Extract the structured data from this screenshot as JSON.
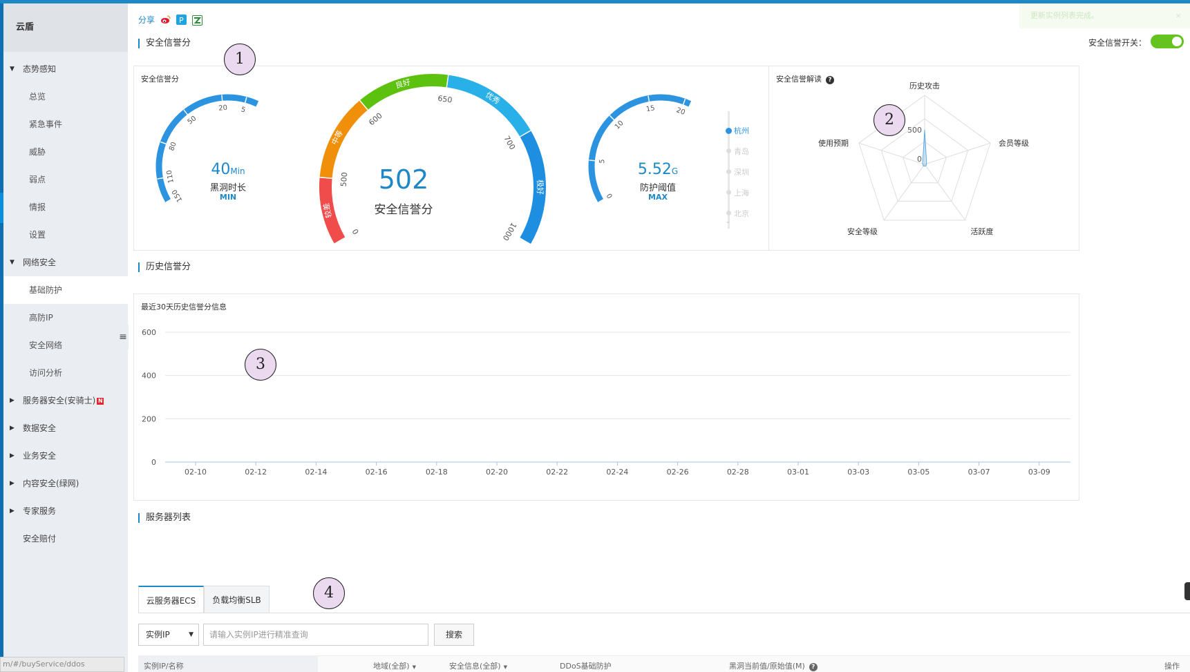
{
  "sidebar": {
    "title": "云盾",
    "items": [
      {
        "label": "态势感知",
        "type": "group",
        "expanded": true
      },
      {
        "label": "总览",
        "type": "child"
      },
      {
        "label": "紧急事件",
        "type": "child"
      },
      {
        "label": "威胁",
        "type": "child"
      },
      {
        "label": "弱点",
        "type": "child"
      },
      {
        "label": "情报",
        "type": "child"
      },
      {
        "label": "设置",
        "type": "child"
      },
      {
        "label": "网络安全",
        "type": "group",
        "expanded": true
      },
      {
        "label": "基础防护",
        "type": "child",
        "active": true
      },
      {
        "label": "高防IP",
        "type": "child"
      },
      {
        "label": "安全网络",
        "type": "child"
      },
      {
        "label": "访问分析",
        "type": "child"
      },
      {
        "label": "服务器安全(安骑士)",
        "type": "group",
        "expanded": false,
        "badge": "N"
      },
      {
        "label": "数据安全",
        "type": "group",
        "expanded": false
      },
      {
        "label": "业务安全",
        "type": "group",
        "expanded": false
      },
      {
        "label": "内容安全(绿网)",
        "type": "group",
        "expanded": false
      },
      {
        "label": "专家服务",
        "type": "group",
        "expanded": false
      },
      {
        "label": "安全赔付",
        "type": "plain"
      }
    ],
    "collapse_icon": "list-icon"
  },
  "header": {
    "share_label": "分享",
    "share_icons": [
      "weibo-icon",
      "qzone-icon",
      "wechat-icon"
    ],
    "toast": "更新实例列表完成。",
    "toast_close": "×"
  },
  "credit_section": {
    "title": "安全信誉分",
    "switch_label": "安全信誉开关：",
    "switch_on": true,
    "panel_title": "安全信誉分",
    "left_gauge": {
      "ticks": [
        "150",
        "110",
        "80",
        "50",
        "20",
        "5"
      ],
      "value": "40",
      "unit": "Min",
      "label": "黑洞时长",
      "sub": "MIN"
    },
    "center_gauge": {
      "ticks": [
        "0",
        "500",
        "600",
        "650",
        "700",
        "1000"
      ],
      "bands": [
        "较差",
        "中等",
        "良好",
        "优秀",
        "极好"
      ],
      "band_colors": [
        "#f04c4c",
        "#f0900a",
        "#5cc10f",
        "#2ab0e8",
        "#1e8ee0"
      ],
      "score": "502",
      "label": "安全信誉分"
    },
    "right_gauge": {
      "ticks": [
        "0",
        "5",
        "10",
        "15",
        "20"
      ],
      "value": "5.52",
      "unit": "G",
      "label": "防护阈值",
      "sub": "MAX"
    },
    "cities": [
      "杭州",
      "青岛",
      "深圳",
      "上海",
      "北京"
    ],
    "active_city": "杭州",
    "more_icon": "chevron-down-icon"
  },
  "radar": {
    "title": "安全信誉解读",
    "help_icon": "question-circle-icon",
    "axes": [
      "历史攻击",
      "会员等级",
      "活跃度",
      "安全等级",
      "使用预期"
    ],
    "tick_labels": [
      "500",
      "0"
    ],
    "values": [
      500,
      0,
      0,
      0,
      0
    ]
  },
  "history_section": {
    "title": "历史信誉分",
    "panel_title": "最近30天历史信誉分信息",
    "chart_data": {
      "type": "line",
      "x": [
        "02-10",
        "02-12",
        "02-14",
        "02-16",
        "02-18",
        "02-20",
        "02-22",
        "02-24",
        "02-26",
        "02-28",
        "03-01",
        "03-03",
        "03-05",
        "03-07",
        "03-09"
      ],
      "yticks": [
        "0",
        "200",
        "400",
        "600"
      ],
      "ylim": [
        0,
        600
      ],
      "series": [],
      "grid": true
    }
  },
  "server_section": {
    "title": "服务器列表",
    "tabs": [
      "云服务器ECS",
      "负载均衡SLB"
    ],
    "active_tab": "云服务器ECS",
    "filter_value": "实例IP",
    "search_placeholder": "请输入实例IP进行精准查询",
    "search_button": "搜索",
    "columns": [
      "实例IP/名称",
      "地域(全部)",
      "安全信息(全部)",
      "DDoS基础防护",
      "黑洞当前值/原始值(M)",
      "操作"
    ]
  },
  "annotations": [
    "1",
    "2",
    "3",
    "4"
  ],
  "statusbar": "m/#/buyService/ddos",
  "colors": {
    "accent": "#1e88c7",
    "switch_on": "#64c31f",
    "gauge_blue": "#2b93e0"
  }
}
